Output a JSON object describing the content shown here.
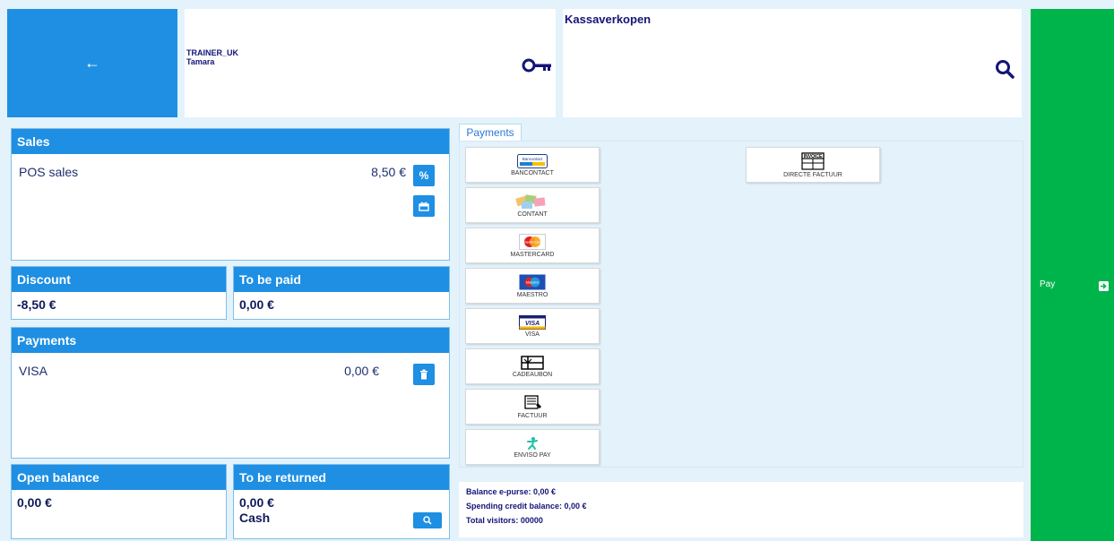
{
  "header": {
    "back_arrow": "←",
    "user_code": "TRAINER_UK",
    "user_name": "Tamara",
    "search_title": "Kassaverkopen"
  },
  "pay_button": {
    "label": "Pay"
  },
  "sales": {
    "title": "Sales",
    "item_label": "POS sales",
    "item_value": "8,50 €",
    "discount_btn_icon": "%"
  },
  "discount": {
    "title": "Discount",
    "value": "-8,50 €"
  },
  "to_be_paid": {
    "title": "To be paid",
    "value": "0,00 €"
  },
  "payments_panel": {
    "title": "Payments",
    "item_label": "VISA",
    "item_value": "0,00 €"
  },
  "open_balance": {
    "title": "Open balance",
    "value": "0,00 €"
  },
  "to_be_returned": {
    "title": "To be returned",
    "value": "0,00 €",
    "method": "Cash"
  },
  "payments_tab": {
    "label": "Payments"
  },
  "methods": [
    {
      "label": "BANCONTACT",
      "logo_text": "Bancontact"
    },
    {
      "label": "CONTANT"
    },
    {
      "label": "MASTERCARD",
      "logo_text": "MasterCard"
    },
    {
      "label": "MAESTRO",
      "logo_text": "Maestro"
    },
    {
      "label": "VISA",
      "logo_text": "VISA"
    },
    {
      "label": "CADEAUBON"
    },
    {
      "label": "FACTUUR"
    },
    {
      "label": "ENVISO PAY"
    },
    {
      "label": "DIRECTE FACTUUR",
      "logo_text": "INVOICE"
    }
  ],
  "balance": {
    "epurse": "Balance e-purse: 0,00 €",
    "spending_credit": "Spending credit balance: 0,00 €",
    "total_visitors": "Total visitors: 00000"
  },
  "colors": {
    "primary": "#1e8fe3",
    "pay_green": "#00b44c",
    "background": "#e3f2fb",
    "text_dark": "#141478"
  },
  "icons": [
    "back-arrow-icon",
    "key-icon",
    "search-icon",
    "percent-icon",
    "gift-icon",
    "trash-icon",
    "exit-arrow-icon"
  ]
}
